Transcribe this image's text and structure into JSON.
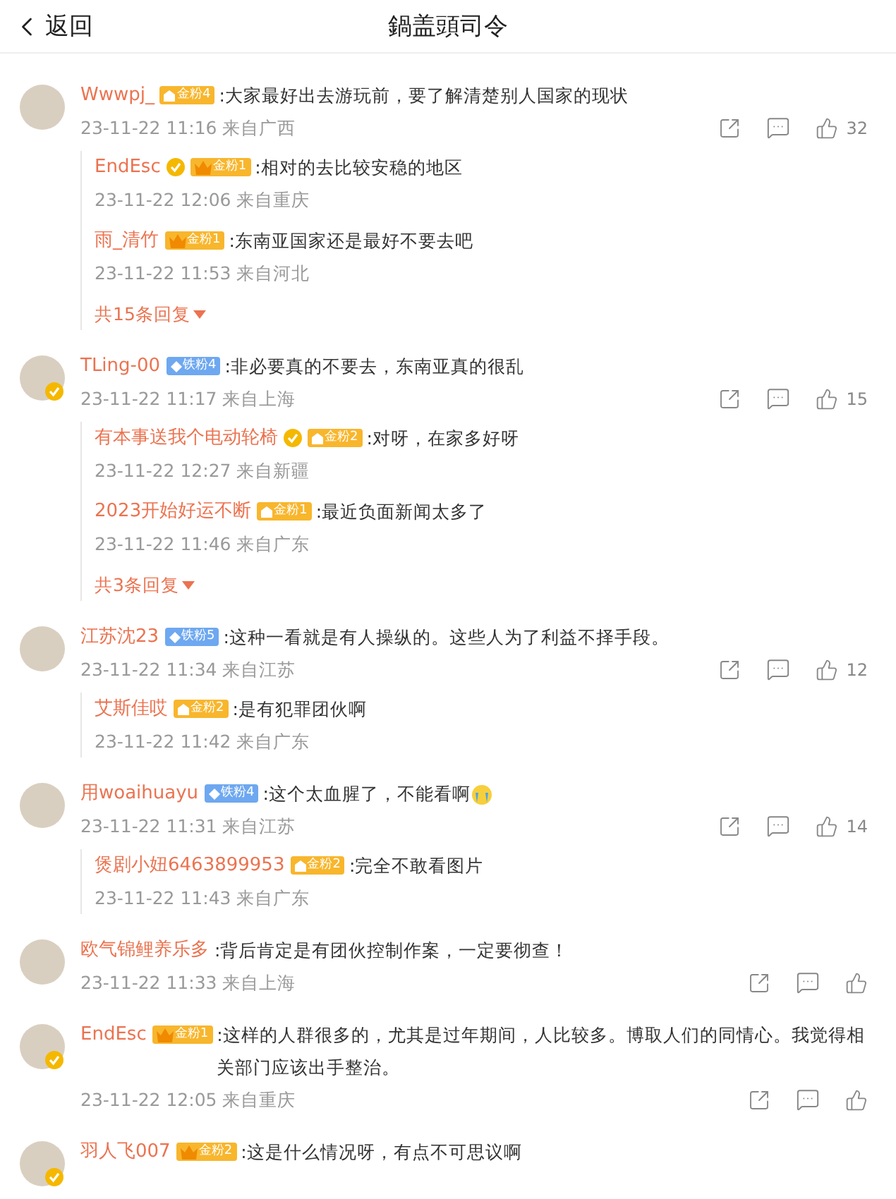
{
  "header": {
    "back": "返回",
    "title": "鍋盖頭司令"
  },
  "comments": [
    {
      "name": "Wwwpj_",
      "verified": false,
      "badge": {
        "kind": "gold",
        "label": "金粉4"
      },
      "text": ":大家最好出去游玩前，要了解清楚别人国家的现状",
      "time": "23-11-22 11:16 来自广西",
      "likes": "32",
      "replies": [
        {
          "name": "EndEsc",
          "verified": true,
          "badge": {
            "kind": "crown",
            "label": "金粉1"
          },
          "text": ":相对的去比较安稳的地区",
          "time": "23-11-22 12:06 来自重庆"
        },
        {
          "name": "雨_清竹",
          "verified": false,
          "badge": {
            "kind": "crown",
            "label": "金粉1"
          },
          "text": ":东南亚国家还是最好不要去吧",
          "time": "23-11-22 11:53 来自河北"
        }
      ],
      "more": "共15条回复"
    },
    {
      "name": "TLing-00",
      "verified": true,
      "badge": {
        "kind": "iron",
        "label": "铁粉4"
      },
      "text": ":非必要真的不要去，东南亚真的很乱",
      "time": "23-11-22 11:17 来自上海",
      "likes": "15",
      "replies": [
        {
          "name": "有本事送我个电动轮椅",
          "verified": true,
          "badge": {
            "kind": "gold",
            "label": "金粉2"
          },
          "text": ":对呀，在家多好呀",
          "time": "23-11-22 12:27 来自新疆"
        },
        {
          "name": "2023开始好运不断",
          "verified": false,
          "badge": {
            "kind": "gold",
            "label": "金粉1"
          },
          "text": ":最近负面新闻太多了",
          "time": "23-11-22 11:46 来自广东"
        }
      ],
      "more": "共3条回复"
    },
    {
      "name": "江苏沈23",
      "verified": false,
      "badge": {
        "kind": "iron",
        "label": "铁粉5"
      },
      "text": ":这种一看就是有人操纵的。这些人为了利益不择手段。",
      "time": "23-11-22 11:34 来自江苏",
      "likes": "12",
      "replies": [
        {
          "name": "艾斯佳哎",
          "verified": false,
          "badge": {
            "kind": "gold",
            "label": "金粉2"
          },
          "text": ":是有犯罪团伙啊",
          "time": "23-11-22 11:42 来自广东"
        }
      ]
    },
    {
      "name": "用woaihuayu",
      "verified": false,
      "badge": {
        "kind": "iron",
        "label": "铁粉4"
      },
      "text": ":这个太血腥了，不能看啊",
      "emoji": true,
      "time": "23-11-22 11:31 来自江苏",
      "likes": "14",
      "replies": [
        {
          "name": "煲剧小妞6463899953",
          "verified": false,
          "badge": {
            "kind": "gold",
            "label": "金粉2"
          },
          "text": ":完全不敢看图片",
          "time": "23-11-22 11:43 来自广东"
        }
      ]
    },
    {
      "name": "欧气锦鲤养乐多",
      "verified": false,
      "text": ":背后肯定是有团伙控制作案，一定要彻查！",
      "time": "23-11-22 11:33 来自上海"
    },
    {
      "name": "EndEsc",
      "verified": true,
      "badge": {
        "kind": "crown",
        "label": "金粉1"
      },
      "text": ":这样的人群很多的，尤其是过年期间，人比较多。博取人们的同情心。我觉得相关部门应该出手整治。",
      "time": "23-11-22 12:05 来自重庆"
    },
    {
      "name": "羽人飞007",
      "verified": true,
      "badge": {
        "kind": "crown",
        "label": "金粉2"
      },
      "text": ":这是什么情况呀，有点不可思议啊"
    }
  ]
}
